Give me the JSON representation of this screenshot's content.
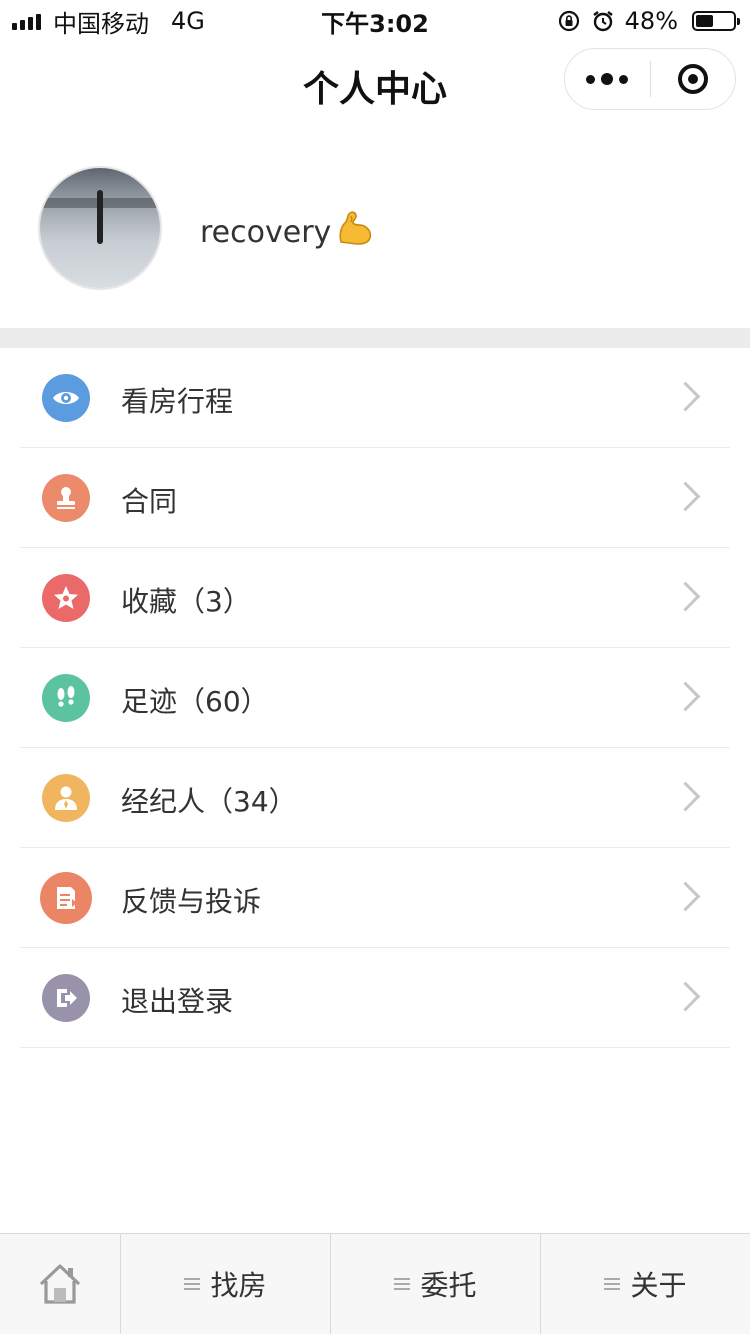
{
  "status_bar": {
    "carrier": "中国移动",
    "network": "4G",
    "time": "下午3:02",
    "battery_percent": "48%",
    "battery_level": 0.48
  },
  "nav": {
    "title": "个人中心"
  },
  "profile": {
    "username": "recovery",
    "emoji": "💪"
  },
  "menu": {
    "items": [
      {
        "label": "看房行程",
        "icon": "eye-icon",
        "color": "#5b9be0"
      },
      {
        "label": "合同",
        "icon": "stamp-icon",
        "color": "#ec8a6c"
      },
      {
        "label": "收藏（3）",
        "icon": "star-icon",
        "color": "#ea6a6a"
      },
      {
        "label": "足迹（60）",
        "icon": "footprints-icon",
        "color": "#5cc3a1"
      },
      {
        "label": "经纪人（34）",
        "icon": "agent-icon",
        "color": "#f0b55e"
      },
      {
        "label": "反馈与投诉",
        "icon": "feedback-icon",
        "color": "#ec8466"
      },
      {
        "label": "退出登录",
        "icon": "logout-icon",
        "color": "#9892ab"
      }
    ]
  },
  "tab_bar": {
    "home_icon": "home-icon",
    "tabs": [
      "找房",
      "委托",
      "关于"
    ]
  }
}
